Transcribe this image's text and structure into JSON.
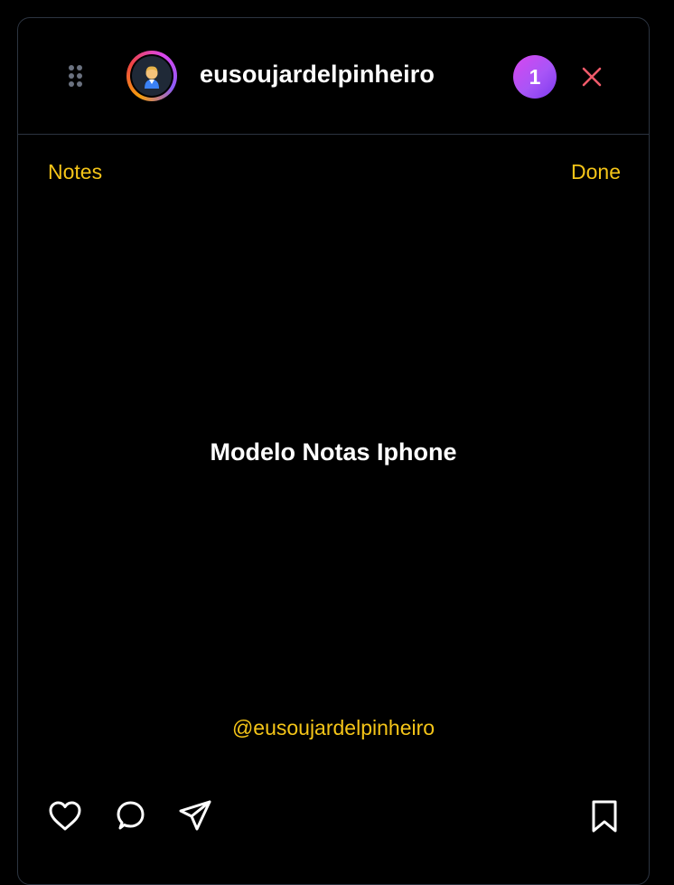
{
  "header": {
    "username": "eusoujardelpinheiro",
    "notification_count": "1"
  },
  "notes": {
    "back_label": "Notes",
    "done_label": "Done",
    "title": "Modelo Notas Iphone",
    "handle": "@eusoujardelpinheiro"
  },
  "icons": {
    "drag": "drag-handle-icon",
    "avatar": "person-emoji-icon",
    "close": "close-icon",
    "like": "heart-icon",
    "comment": "comment-icon",
    "share": "send-icon",
    "save": "bookmark-icon"
  },
  "colors": {
    "accent": "#f5c518",
    "close": "#f05a6a",
    "badge": "#a855f7",
    "border": "#2c3440"
  }
}
